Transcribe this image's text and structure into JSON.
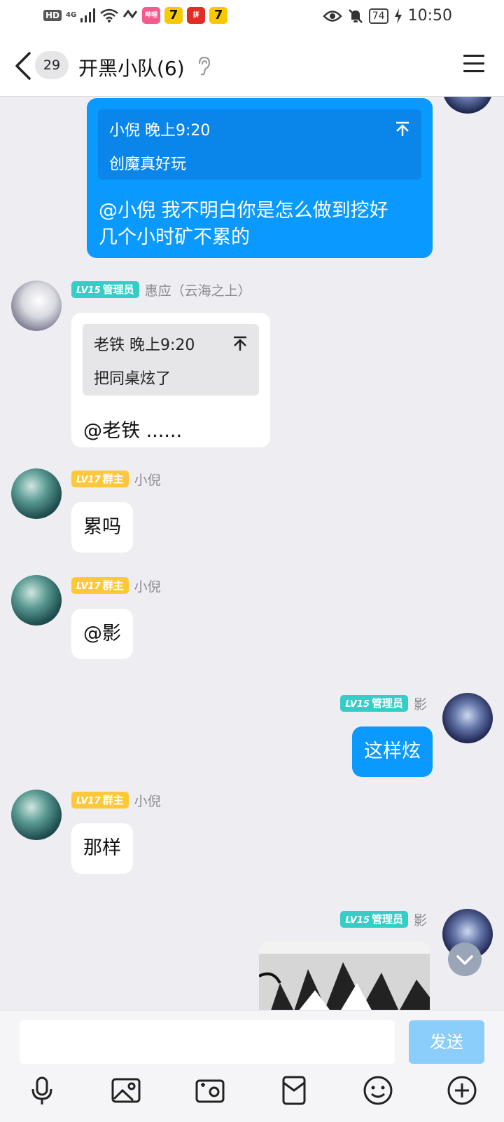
{
  "status_bar": {
    "hd": "HD",
    "network": "4G",
    "apps": [
      {
        "name": "bilibili-comic-app",
        "color": "#f45a8d",
        "label": "哔哩"
      },
      {
        "name": "qimao-app",
        "color": "#f9c900",
        "label": "7"
      },
      {
        "name": "pinduoduo-app",
        "color": "#e02e24",
        "label": "拼"
      },
      {
        "name": "qimao-app-2",
        "color": "#f9c900",
        "label": "7"
      }
    ],
    "battery": "74",
    "time": "10:50"
  },
  "header": {
    "unread_count": "29",
    "title": "开黑小队(6)"
  },
  "messages": {
    "m1": {
      "quote_sender_time": "小倪 晚上9:20",
      "quote_text": "创魔真好玩",
      "text_line1": "@小倪 我不明白你是怎么做到挖好",
      "text_line2": "几个小时矿不累的"
    },
    "m2": {
      "level": "LV15",
      "role": "管理员",
      "sender": "惠应（云海之上）",
      "quote_sender_time": "老铁 晚上9:20",
      "quote_text": "把同桌炫了",
      "text": "@老铁 ......"
    },
    "m3": {
      "level": "LV17",
      "role": "群主",
      "sender": "小倪",
      "text": "累吗"
    },
    "m4": {
      "level": "LV17",
      "role": "群主",
      "sender": "小倪",
      "text": "@影"
    },
    "m5": {
      "level": "LV15",
      "role": "管理员",
      "sender": "影",
      "text": "这样炫"
    },
    "m6": {
      "level": "LV17",
      "role": "群主",
      "sender": "小倪",
      "text": "那样"
    },
    "m7": {
      "level": "LV15",
      "role": "管理员",
      "sender": "影"
    }
  },
  "input": {
    "placeholder": "",
    "send_label": "发送"
  },
  "colors": {
    "accent": "#0a99ff",
    "admin_tag": "#37cdc7",
    "owner_tag": "#ffc83a"
  }
}
